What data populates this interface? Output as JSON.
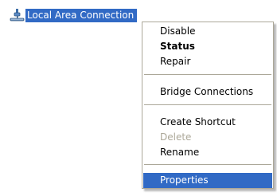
{
  "connection": {
    "label": "Local Area Connection",
    "icon": "network-connection-icon",
    "selected": true
  },
  "context_menu": {
    "items": [
      {
        "label": "Disable",
        "style": "normal"
      },
      {
        "label": "Status",
        "style": "bold"
      },
      {
        "label": "Repair",
        "style": "normal"
      },
      {
        "label": "Bridge Connections",
        "style": "normal"
      },
      {
        "label": "Create Shortcut",
        "style": "normal"
      },
      {
        "label": "Delete",
        "style": "disabled"
      },
      {
        "label": "Rename",
        "style": "normal"
      },
      {
        "label": "Properties",
        "style": "highlighted"
      }
    ]
  },
  "colors": {
    "selection": "#316ac5",
    "disabled_text": "#aca899",
    "menu_border": "#aca899"
  }
}
